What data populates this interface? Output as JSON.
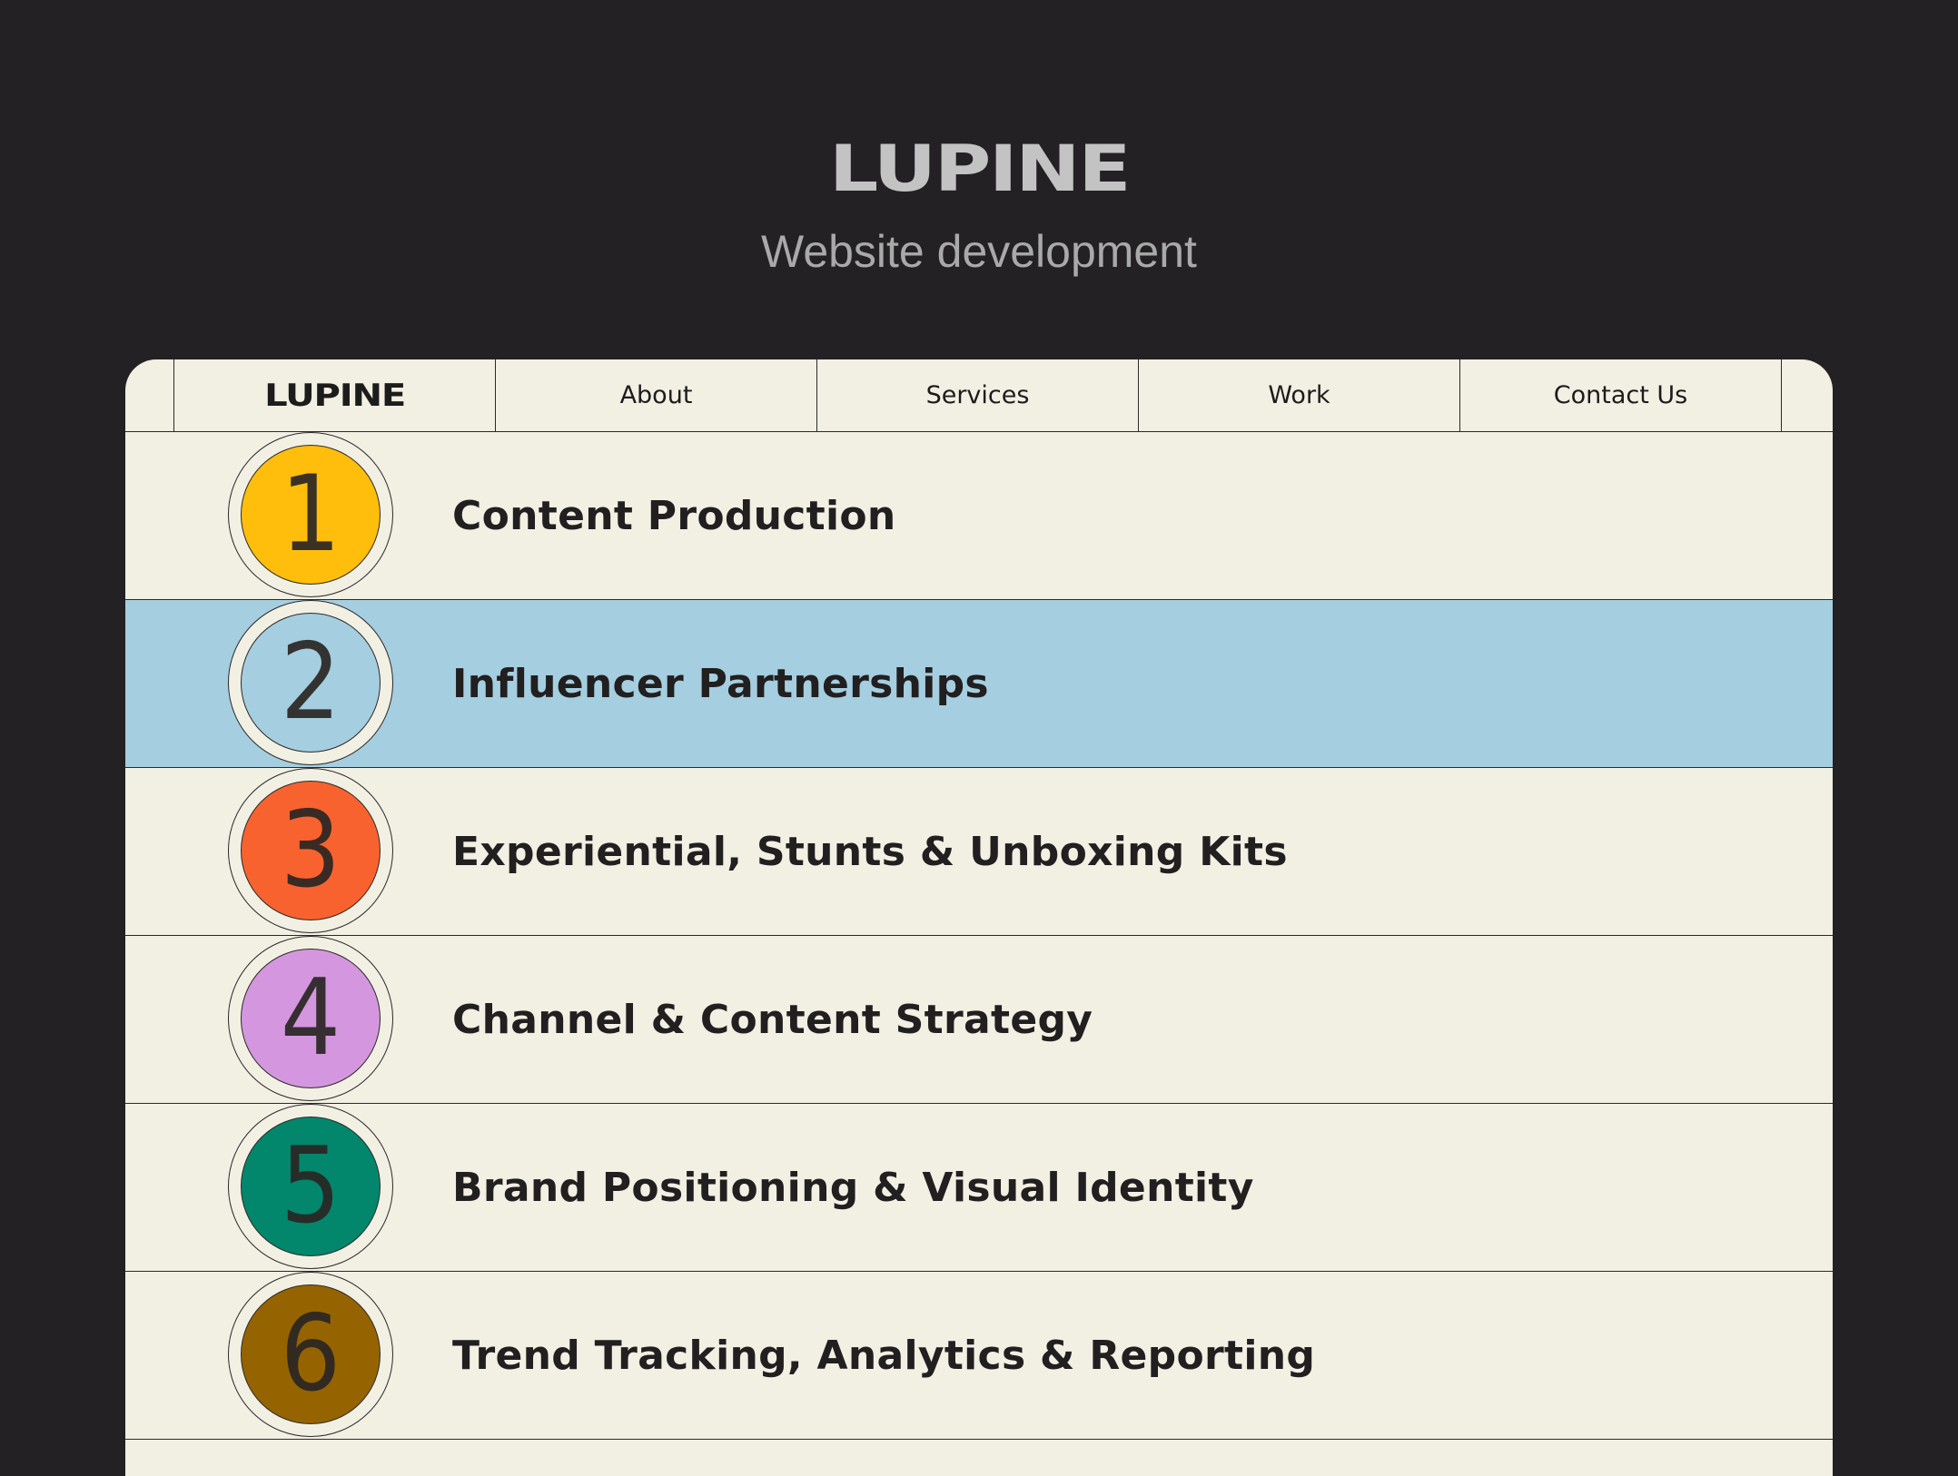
{
  "hero": {
    "logo": "LUPINE",
    "subtitle": "Website development"
  },
  "nav": {
    "logo": "LUPINE",
    "items": [
      {
        "label": "About"
      },
      {
        "label": "Services"
      },
      {
        "label": "Work"
      },
      {
        "label": "Contact Us"
      }
    ]
  },
  "services": [
    {
      "number": "1",
      "label": "Content Production",
      "color": "#FFBE0B",
      "highlighted": false
    },
    {
      "number": "2",
      "label": "Influencer Partnerships",
      "color": "#A5CEE0",
      "highlighted": true
    },
    {
      "number": "3",
      "label": "Experiential, Stunts & Unboxing Kits",
      "color": "#F8622F",
      "highlighted": false
    },
    {
      "number": "4",
      "label": "Channel & Content Strategy",
      "color": "#D497DF",
      "highlighted": false
    },
    {
      "number": "5",
      "label": "Brand Positioning & Visual Identity",
      "color": "#02876C",
      "highlighted": false
    },
    {
      "number": "6",
      "label": "Trend Tracking, Analytics & Reporting",
      "color": "#956400",
      "highlighted": false
    }
  ],
  "colors": {
    "background": "#232124",
    "card": "#F2EFE3",
    "highlight_row": "#A5CEE0",
    "text": "#211F1F"
  }
}
